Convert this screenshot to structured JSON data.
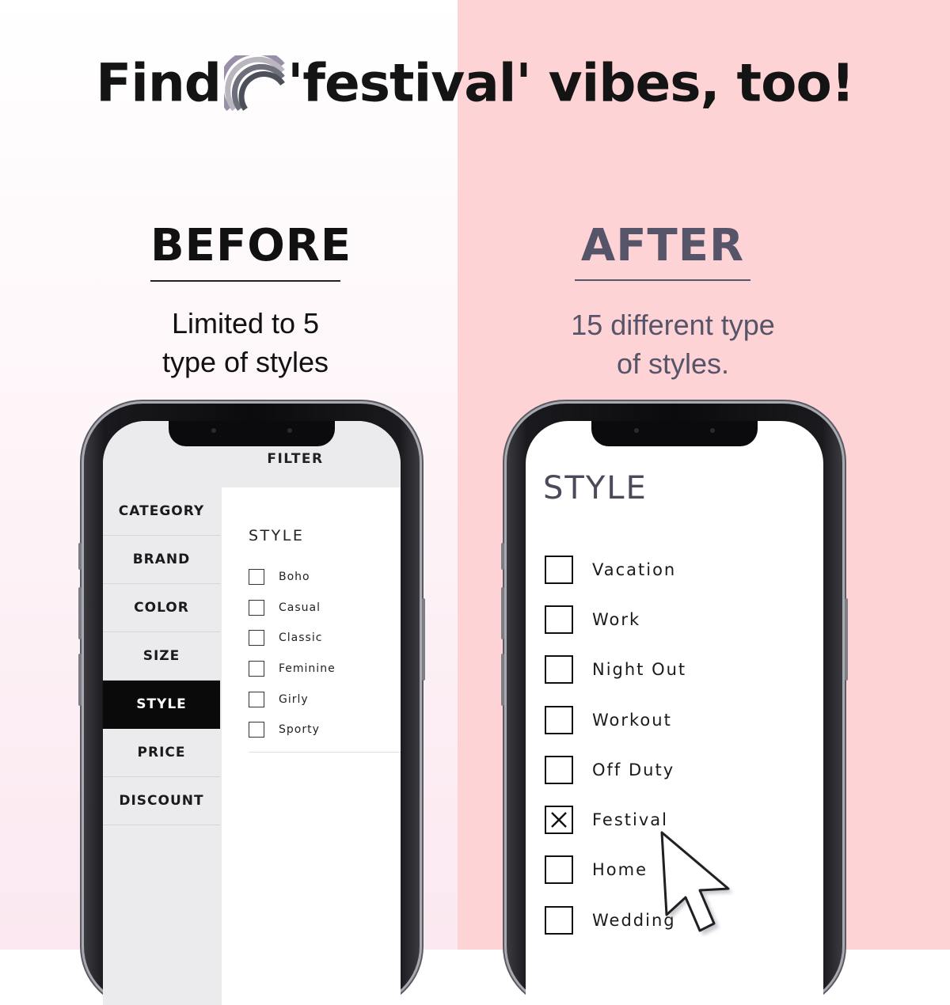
{
  "headline": {
    "before_icon": "Find",
    "after_icon": "'festival' vibes, too!",
    "icon": "rainbow-icon"
  },
  "before": {
    "title": "BEFORE",
    "subtitle_line1": "Limited to 5",
    "subtitle_line2": "type of styles",
    "screen": {
      "header": "FILTER",
      "nav": [
        "CATEGORY",
        "BRAND",
        "COLOR",
        "SIZE",
        "STYLE",
        "PRICE",
        "DISCOUNT"
      ],
      "active_nav": "STYLE",
      "panel_title": "STYLE",
      "options": [
        "Boho",
        "Casual",
        "Classic",
        "Feminine",
        "Girly",
        "Sporty"
      ]
    }
  },
  "after": {
    "title": "AFTER",
    "subtitle_line1": "15 different type",
    "subtitle_line2": "of styles.",
    "screen": {
      "panel_title": "STYLE",
      "options": [
        {
          "label": "Vacation",
          "checked": false
        },
        {
          "label": "Work",
          "checked": false
        },
        {
          "label": "Night Out",
          "checked": false
        },
        {
          "label": "Workout",
          "checked": false
        },
        {
          "label": "Off Duty",
          "checked": false
        },
        {
          "label": "Festival",
          "checked": true
        },
        {
          "label": "Home",
          "checked": false
        },
        {
          "label": "Wedding",
          "checked": false
        }
      ]
    }
  },
  "colors": {
    "left_bg": "#ffffff",
    "right_bg": "#fdd3d6",
    "accent_text": "#565468",
    "dark": "#111111"
  }
}
